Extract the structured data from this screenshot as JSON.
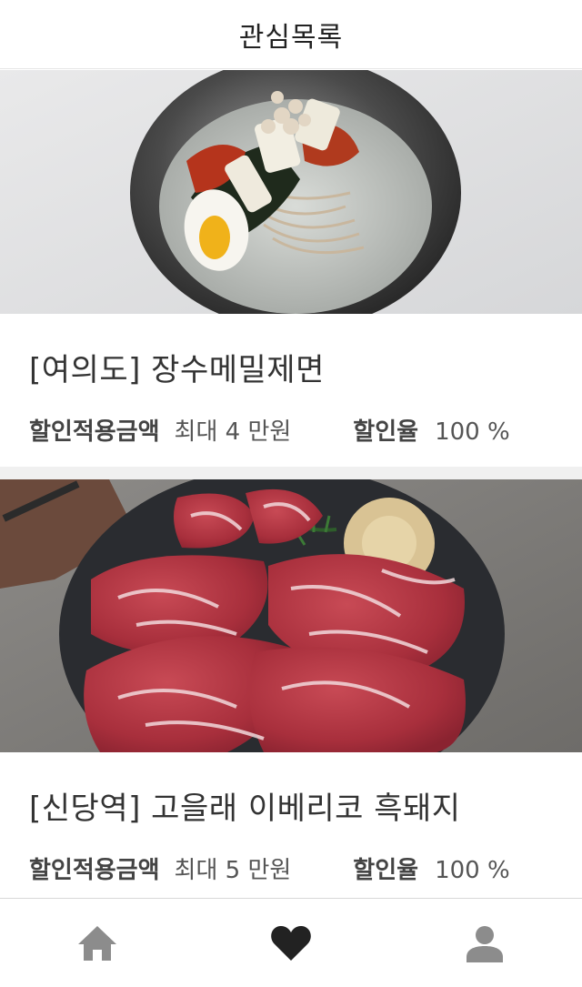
{
  "header": {
    "title": "관심목록"
  },
  "cards": [
    {
      "image_subject": "bowl of cold buckwheat noodles",
      "title": "[여의도] 장수메밀제면",
      "discount_amount_label": "할인적용금액",
      "discount_amount_value": "최대 4 만원",
      "discount_rate_label": "할인율",
      "discount_rate_value": "100 %"
    },
    {
      "image_subject": "raw marbled pork on slate platter",
      "title": "[신당역] 고을래 이베리코 흑돼지",
      "discount_amount_label": "할인적용금액",
      "discount_amount_value": "최대 5 만원",
      "discount_rate_label": "할인율",
      "discount_rate_value": "100 %"
    }
  ],
  "tabbar": {
    "items": [
      {
        "icon": "home-icon",
        "active": false
      },
      {
        "icon": "heart-icon",
        "active": true
      },
      {
        "icon": "person-icon",
        "active": false
      }
    ],
    "active_color": "#222222",
    "inactive_color": "#8c8c8c"
  }
}
